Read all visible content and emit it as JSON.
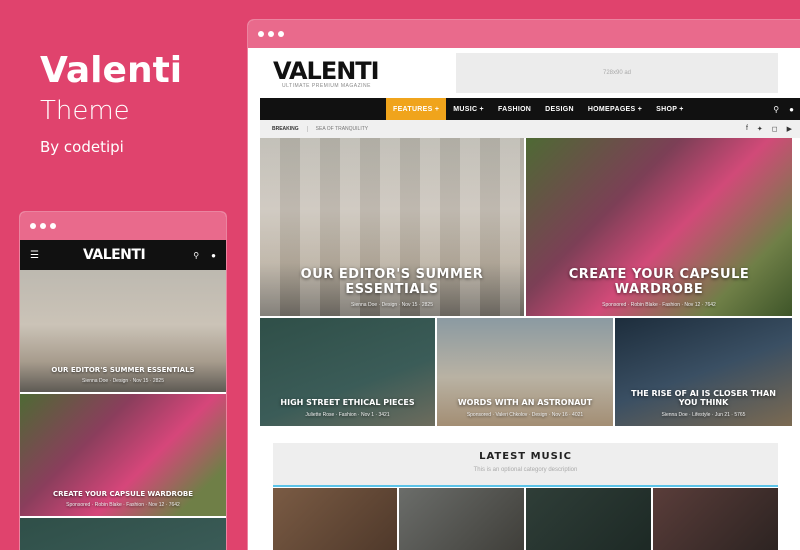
{
  "brand": {
    "title": "Valenti",
    "subtitle": "Theme",
    "by": "By codetipi"
  },
  "site": {
    "logo": "VALENTI",
    "tagline": "ULTIMATE PREMIUM MAGAZINE",
    "ad_label": "728x90 ad"
  },
  "nav": {
    "items": [
      "FEATURES +",
      "MUSIC +",
      "FASHION",
      "DESIGN",
      "HOMEPAGES +",
      "SHOP +"
    ],
    "active_index": 0
  },
  "breaking": {
    "label": "BREAKING",
    "text": "SEA OF TRANQUILITY"
  },
  "icons": {
    "search": "search-icon",
    "user": "user-icon",
    "social": [
      "facebook-icon",
      "twitter-icon",
      "instagram-icon",
      "youtube-icon"
    ]
  },
  "features": [
    {
      "title": "OUR EDITOR'S SUMMER ESSENTIALS",
      "meta": "Sienna Doe  ·  Design  ·  Nov 15  ·  2825"
    },
    {
      "title": "CREATE YOUR CAPSULE WARDROBE",
      "meta": "Sponsored  ·  Robin Blake  ·  Fashion  ·  Nov 12  ·  7642"
    },
    {
      "title": "HIGH STREET ETHICAL PIECES",
      "meta": "Juliette Rose  ·  Fashion  ·  Nov 1  ·  3421"
    },
    {
      "title": "WORDS WITH AN ASTRONAUT",
      "meta": "Sponsored  ·  Valeri Chkolov  ·  Design  ·  Nov 16  ·  4021"
    },
    {
      "title": "THE RISE OF AI IS CLOSER THAN YOU THINK",
      "meta": "Sienna Doe  ·  Lifestyle  ·  Jun 21  ·  5765"
    }
  ],
  "section": {
    "title": "LATEST MUSIC",
    "description": "This is an optional category description"
  },
  "mobile": {
    "logo": "VALENTI",
    "tiles": [
      {
        "title": "OUR EDITOR'S SUMMER ESSENTIALS",
        "meta": "Sienna Doe  ·  Design  ·  Nov 15  ·  2825"
      },
      {
        "title": "CREATE YOUR CAPSULE WARDROBE",
        "meta": "Sponsored  ·  Robin Blake  ·  Fashion  ·  Nov 12  ·  7642"
      }
    ]
  },
  "colors": {
    "background": "#e0436d",
    "accent": "#f0a41c",
    "nav": "#111111",
    "section_rule": "#5bc3e8"
  }
}
